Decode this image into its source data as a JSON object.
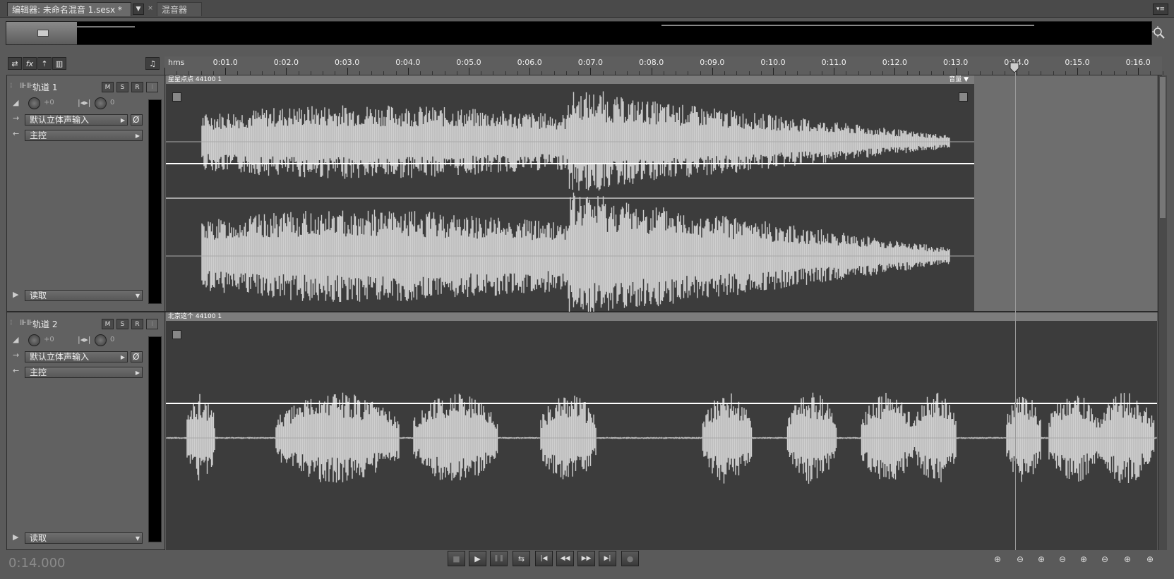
{
  "tabs": {
    "editor_label": "编辑器: 未命名混音 1.sesx *",
    "dropdown_glyph": "▼",
    "close_glyph": "×",
    "mixer_label": "混音器",
    "panel_menu_glyph": "▾≡"
  },
  "toolbar": {
    "loop_glyph": "⇄",
    "fx_label": "fx",
    "sends_glyph": "⇡",
    "eq_glyph": "▥",
    "headphones_glyph": "♫"
  },
  "ruler": {
    "unit_label": "hms",
    "labels": [
      "0:01.0",
      "0:02.0",
      "0:03.0",
      "0:04.0",
      "0:05.0",
      "0:06.0",
      "0:07.0",
      "0:08.0",
      "0:09.0",
      "0:10.0",
      "0:11.0",
      "0:12.0",
      "0:13.0",
      "0:14.0",
      "0:15.0",
      "0:16.0"
    ]
  },
  "tracks": [
    {
      "name": "轨道 1",
      "mute": "M",
      "solo": "S",
      "record": "R",
      "input_monitor": "I",
      "volume": "+0",
      "pan": "0",
      "input": "默认立体声输入",
      "output": "主控",
      "automation": "读取",
      "clip_label": "星星点点 44100 1",
      "clip_control": "音量"
    },
    {
      "name": "轨道 2",
      "mute": "M",
      "solo": "S",
      "record": "R",
      "input_monitor": "I",
      "volume": "+0",
      "pan": "0",
      "input": "默认立体声输入",
      "output": "主控",
      "automation": "读取",
      "clip_label": "北京这个 44100 1"
    }
  ],
  "playhead": {
    "time": "0:14.000"
  },
  "transport": {
    "stop": "■",
    "play": "▶",
    "pause": "❚❚",
    "loop": "⇆",
    "to_start": "|◀",
    "rewind": "◀◀",
    "forward": "▶▶",
    "to_end": "▶|",
    "record": "●"
  },
  "zoom_controls": [
    "⊕",
    "⊖",
    "⊕",
    "⊖",
    "⊕",
    "⊖",
    "⊕",
    "⊕"
  ]
}
